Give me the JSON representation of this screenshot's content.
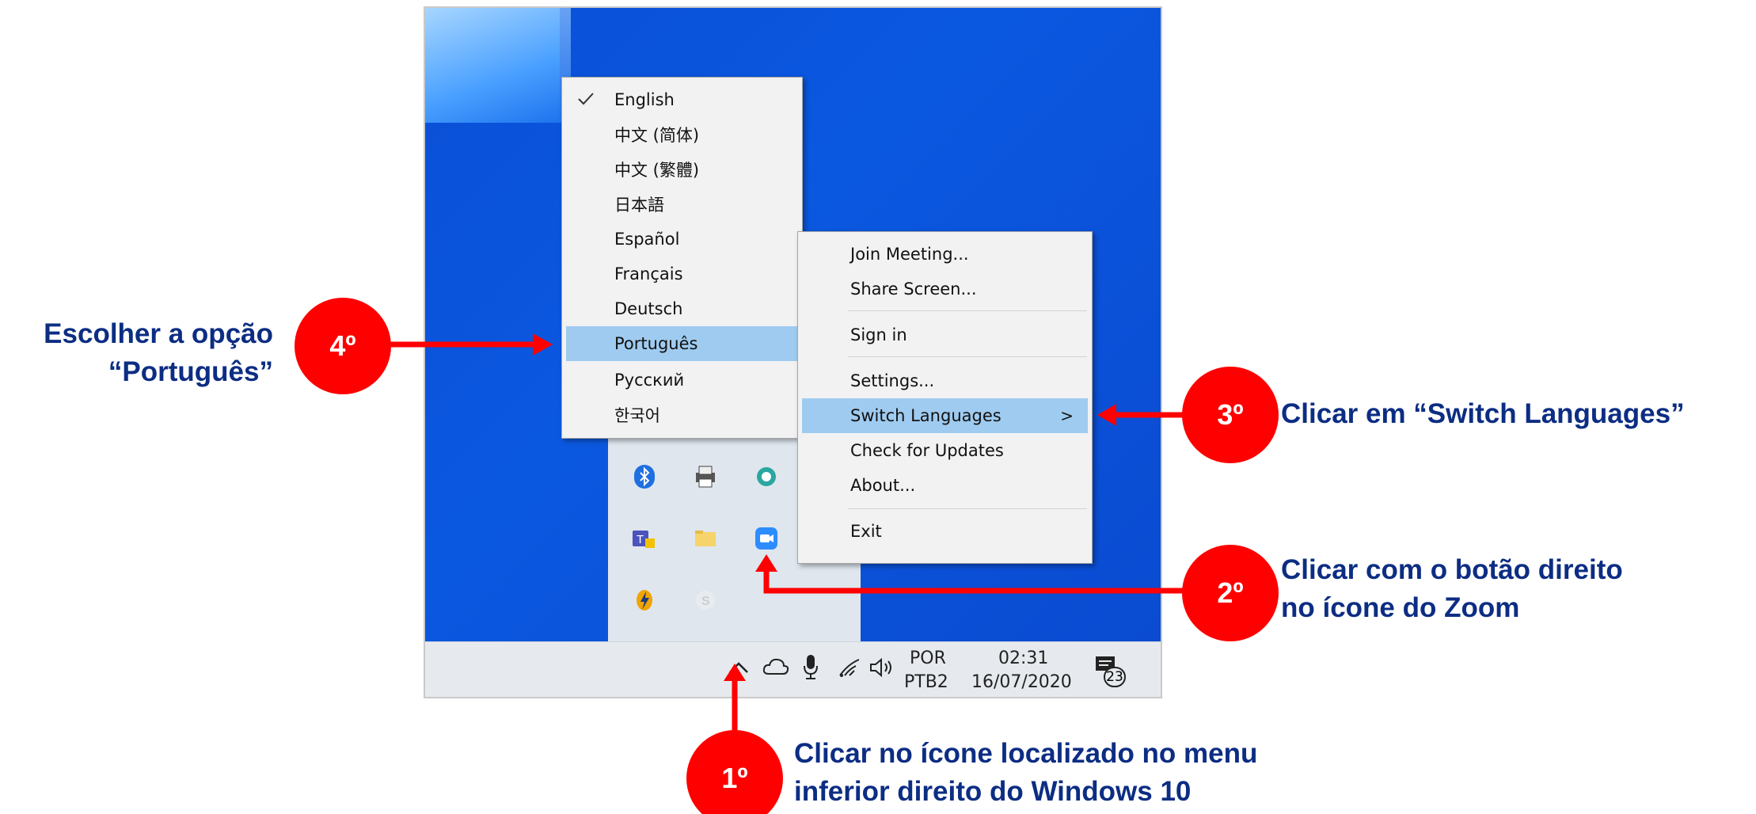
{
  "colors": {
    "accent_red": "#ff0000",
    "caption_blue": "#0c2d83",
    "menu_highlight": "#9fcbf0",
    "desktop_blue": "#0a4fd6"
  },
  "language_menu": {
    "check_icon": "check-icon",
    "items": [
      "English",
      "中文 (简体)",
      "中文 (繁體)",
      "日本語",
      "Español",
      "Français",
      "Deutsch",
      "Português",
      "Русский",
      "한국어"
    ],
    "checked": "English",
    "highlighted": "Português"
  },
  "zoom_menu": {
    "items": [
      "Join Meeting...",
      "Share Screen...",
      "Sign in",
      "Settings...",
      "Switch Languages",
      "Check for Updates",
      "About...",
      "Exit"
    ],
    "submenu_arrow": ">",
    "highlighted": "Switch Languages"
  },
  "tray_icons": [
    "bluetooth-icon",
    "printer-icon",
    "app-icon",
    "teams-icon",
    "folder-icon",
    "zoom-icon",
    "power-icon",
    "skype-icon"
  ],
  "taskbar": {
    "icons": [
      "chevron-up-icon",
      "cloud-icon",
      "microphone-icon",
      "wifi-icon",
      "speaker-icon"
    ],
    "lang_top": "POR",
    "lang_bottom": "PTB2",
    "time": "02:31",
    "date": "16/07/2020",
    "notification_count": "23"
  },
  "steps": {
    "s1": {
      "badge": "1º",
      "text1": "Clicar no ícone localizado no menu",
      "text2": "inferior direito do Windows 10"
    },
    "s2": {
      "badge": "2º",
      "text1": "Clicar com o botão direito",
      "text2": "no ícone do Zoom"
    },
    "s3": {
      "badge": "3º",
      "text1": "Clicar em “Switch Languages”"
    },
    "s4": {
      "badge": "4º",
      "text1": "Escolher a opção",
      "text2": "“Português”"
    }
  }
}
